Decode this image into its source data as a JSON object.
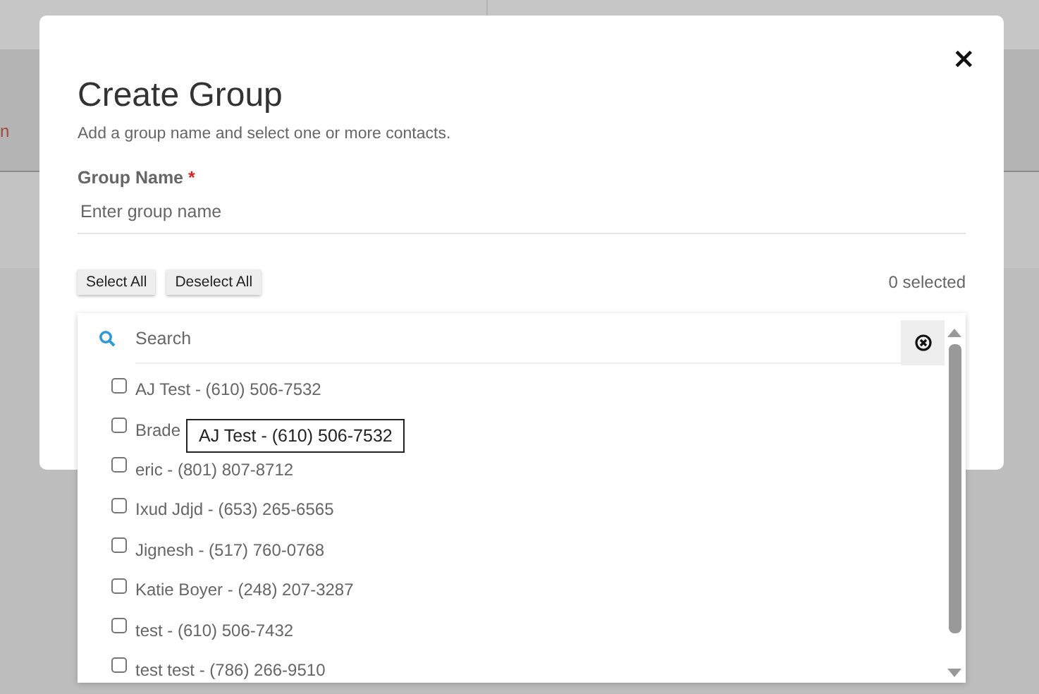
{
  "background": {
    "row_text": "n"
  },
  "dialog": {
    "title": "Create Group",
    "close": "×",
    "subtitle": "Add a group name and select one or more contacts.",
    "field_label": "Group Name",
    "required_mark": "*",
    "placeholder": "Enter group name",
    "buttons": [
      "Select All",
      "Deselect All"
    ],
    "selected_count": "0 selected"
  },
  "contact_list": {
    "search_placeholder": "Search",
    "items": [
      {
        "label": "AJ Test - (610) 506-7532",
        "checked": false
      },
      {
        "label": "Brade",
        "checked": false
      },
      {
        "label": "eric - (801) 807-8712",
        "checked": false
      },
      {
        "label": "Ixud Jdjd - (653) 265-6565",
        "checked": false
      },
      {
        "label": "Jignesh - (517) 760-0768",
        "checked": false
      },
      {
        "label": "Katie Boyer - (248) 207-3287",
        "checked": false
      },
      {
        "label": "test - (610) 506-7432",
        "checked": false
      },
      {
        "label": "test test - (786) 266-9510",
        "checked": false
      }
    ],
    "tooltip": "AJ Test - (610) 506-7532"
  }
}
